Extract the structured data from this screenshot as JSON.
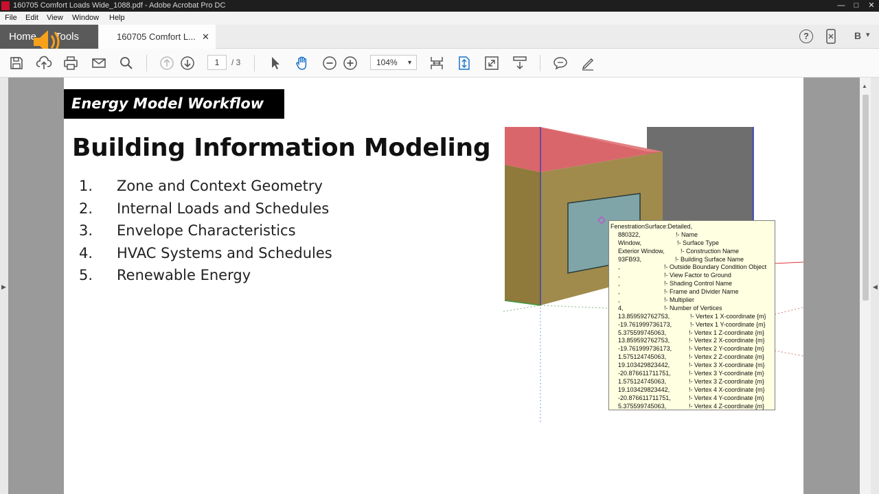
{
  "window": {
    "title": "160705 Comfort Loads Wide_1088.pdf - Adobe Acrobat Pro DC",
    "minimize": "—",
    "maximize": "□",
    "close": "✕"
  },
  "menu": [
    "File",
    "Edit",
    "View",
    "Window",
    "Help"
  ],
  "tabs": {
    "home": "Home",
    "tools": "Tools",
    "document": "160705 Comfort L...",
    "close": "✕",
    "help_icon": "?",
    "account_initial": "B",
    "account_caret": "▾"
  },
  "toolbar": {
    "page_current": "1",
    "page_total": "/ 3",
    "zoom": "104%",
    "zoom_caret": "▼"
  },
  "slide": {
    "banner": "Energy Model Workflow",
    "heading": "Building Information Modeling",
    "items": [
      {
        "num": "1.",
        "text": "Zone and Context Geometry"
      },
      {
        "num": "2.",
        "text": "Internal Loads and Schedules"
      },
      {
        "num": "3.",
        "text": "Envelope Characteristics"
      },
      {
        "num": "4.",
        "text": "HVAC Systems and Schedules"
      },
      {
        "num": "5.",
        "text": "Renewable Energy"
      }
    ]
  },
  "tooltip": {
    "header": "FenestrationSurface:Detailed,",
    "rows": [
      {
        "v": "880322,",
        "c": "!- Name"
      },
      {
        "v": "Window,",
        "c": "!- Surface Type"
      },
      {
        "v": "Exterior Window,",
        "c": "!- Construction Name"
      },
      {
        "v": "93FB93,",
        "c": "!- Building Surface Name"
      },
      {
        "v": ",",
        "c": "!- Outside Boundary Condition Object"
      },
      {
        "v": ",",
        "c": "!- View Factor to Ground"
      },
      {
        "v": ",",
        "c": "!- Shading Control Name"
      },
      {
        "v": ",",
        "c": "!- Frame and Divider Name"
      },
      {
        "v": ",",
        "c": "!- Multiplier"
      },
      {
        "v": "4,",
        "c": "!- Number of Vertices"
      },
      {
        "v": "13.859592762753,",
        "c": "!- Vertex 1 X-coordinate {m}"
      },
      {
        "v": "-19.761999736173,",
        "c": "!- Vertex 1 Y-coordinate {m}"
      },
      {
        "v": "5.375599745063,",
        "c": "!- Vertex 1 Z-coordinate {m}"
      },
      {
        "v": "13.859592762753,",
        "c": "!- Vertex 2 X-coordinate {m}"
      },
      {
        "v": "-19.761999736173,",
        "c": "!- Vertex 2 Y-coordinate {m}"
      },
      {
        "v": "1.575124745063,",
        "c": "!- Vertex 2 Z-coordinate {m}"
      },
      {
        "v": "19.103429823442,",
        "c": "!- Vertex 3 X-coordinate {m}"
      },
      {
        "v": "-20.876611711751,",
        "c": "!- Vertex 3 Y-coordinate {m}"
      },
      {
        "v": "1.575124745063,",
        "c": "!- Vertex 3 Z-coordinate {m}"
      },
      {
        "v": "19.103429823442,",
        "c": "!- Vertex 4 X-coordinate {m}"
      },
      {
        "v": "-20.876611711751,",
        "c": "!- Vertex 4 Y-coordinate {m}"
      },
      {
        "v": "5.375599745063,",
        "c": "!- Vertex 4 Z-coordinate {m}"
      }
    ]
  },
  "colors": {
    "titlebar": "#1e1e1e",
    "home_tab": "#5a5a5a",
    "roof": "#d9666b",
    "wall": "#a08b4c",
    "window_glass": "#7fa5a8",
    "context_building": "#6e6e6e",
    "tooltip_bg": "#ffffe1"
  },
  "icons": [
    "save-icon",
    "upload-icon",
    "print-icon",
    "email-icon",
    "search-icon",
    "page-up-icon",
    "page-down-icon",
    "select-arrow-icon",
    "hand-icon",
    "zoom-out-icon",
    "zoom-in-icon",
    "fit-width-icon",
    "scroll-mode-icon",
    "full-screen-icon",
    "read-mode-icon",
    "comment-icon",
    "sign-pen-icon",
    "speaker-icon"
  ]
}
